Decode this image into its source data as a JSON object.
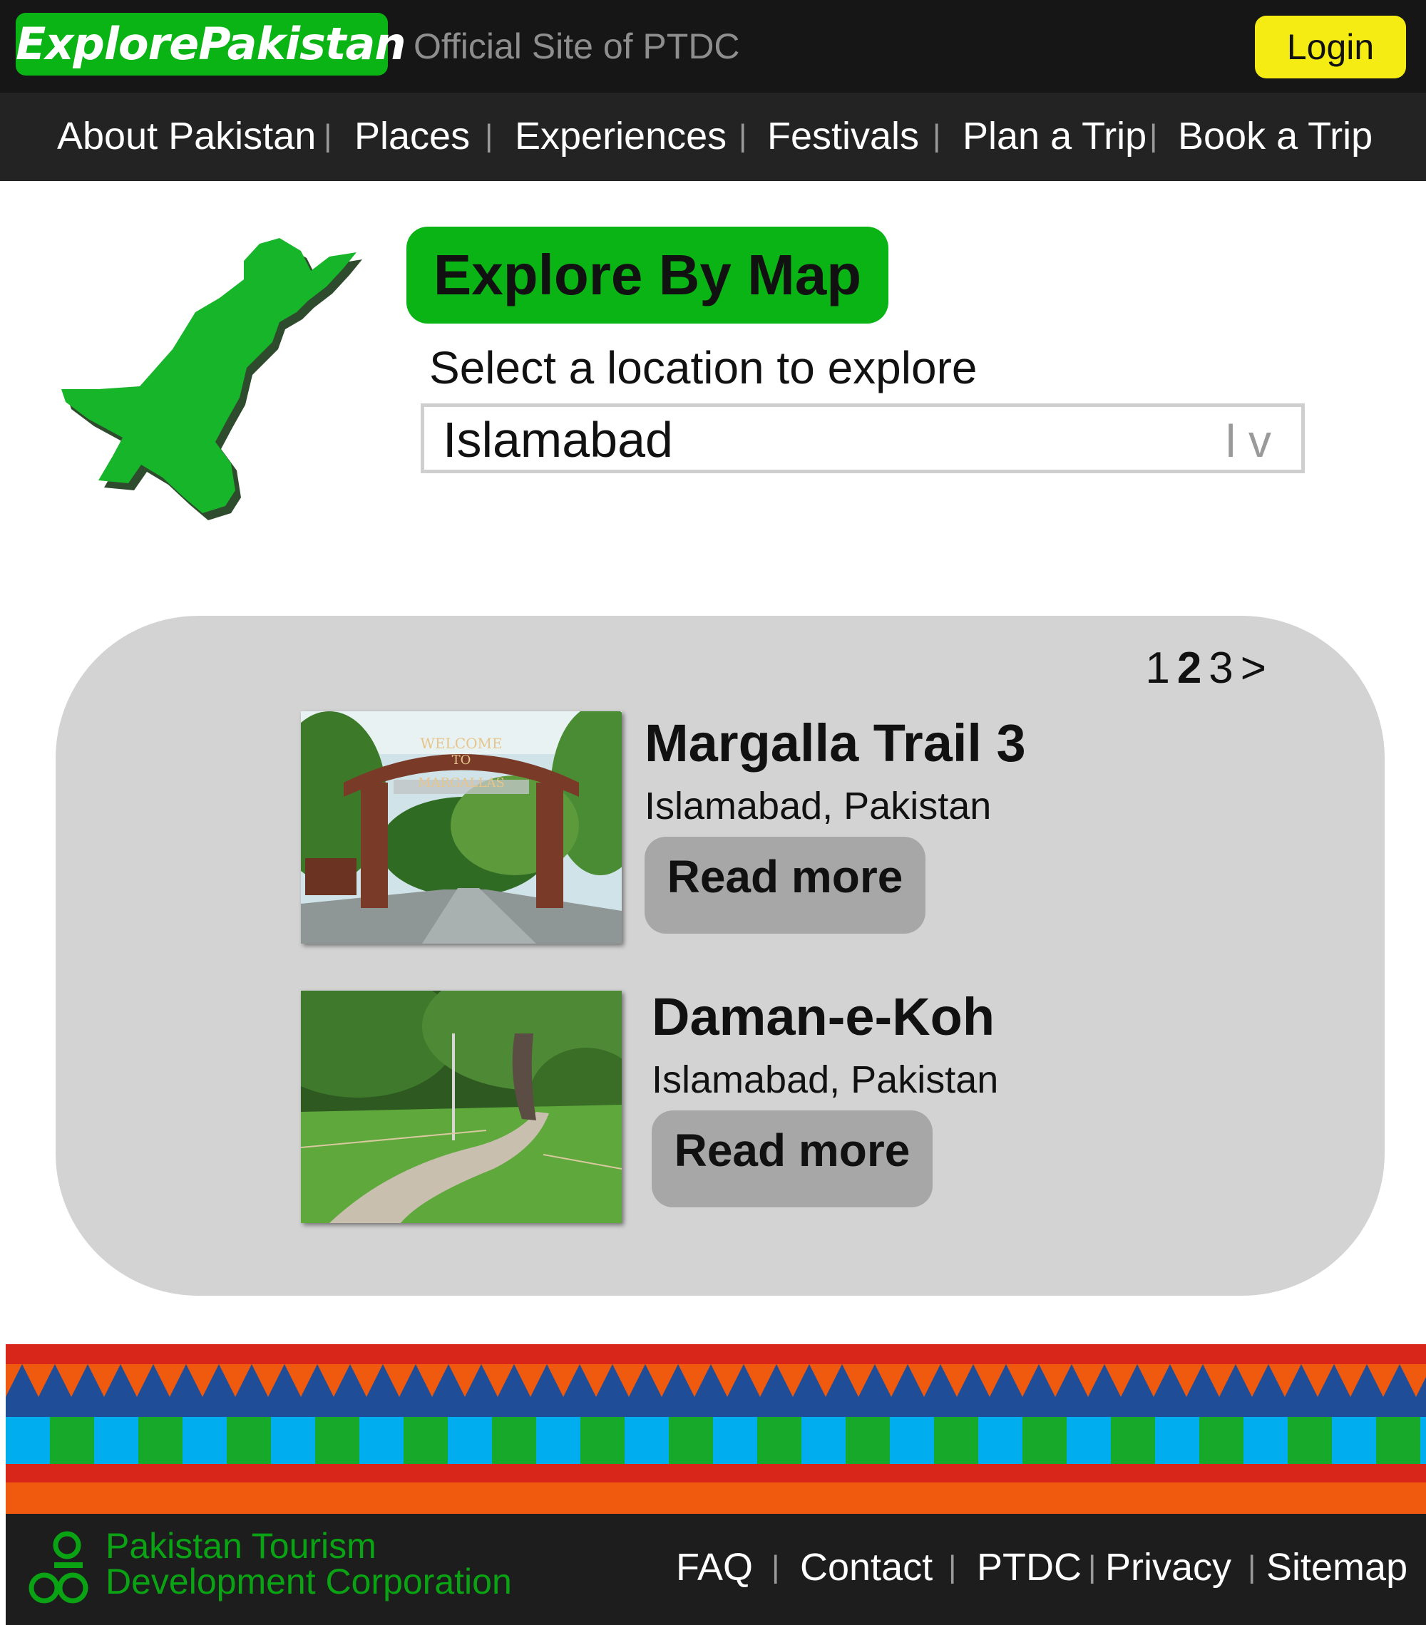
{
  "header": {
    "logo_text": "ExplorePakistan",
    "tagline": "Official Site of PTDC",
    "login_label": "Login"
  },
  "nav": {
    "items": [
      "About Pakistan",
      "Places",
      "Experiences",
      "Festivals",
      "Plan a Trip",
      "Book a Trip"
    ],
    "separator": "|"
  },
  "hero": {
    "title": "Explore By Map",
    "select_label": "Select a location to explore",
    "selected_location": "Islamabad",
    "select_caret": "l v",
    "map_icon": "pakistan-map-icon"
  },
  "results": {
    "pages": [
      "1",
      "2",
      "3"
    ],
    "current_page": "2",
    "next_label": ">",
    "items": [
      {
        "title": "Margalla Trail 3",
        "location": "Islamabad, Pakistan",
        "read_more": "Read more",
        "sign_text": [
          "WELCOME",
          "TO",
          "MARGALLAS"
        ]
      },
      {
        "title": "Daman-e-Koh",
        "location": "Islamabad, Pakistan",
        "read_more": "Read more"
      }
    ]
  },
  "footer": {
    "org_line1": "Pakistan Tourism",
    "org_line2": "Development Corporation",
    "links": [
      "FAQ",
      "Contact",
      "PTDC",
      "Privacy",
      "Sitemap"
    ],
    "separator": "|"
  },
  "colors": {
    "brand_green": "#09b414",
    "login_yellow": "#f5ec14",
    "band_red": "#d9261b",
    "band_orange": "#f05a0f",
    "band_blue": "#1f4d97",
    "band_cyan": "#00aeef",
    "band_green": "#16a92a"
  }
}
